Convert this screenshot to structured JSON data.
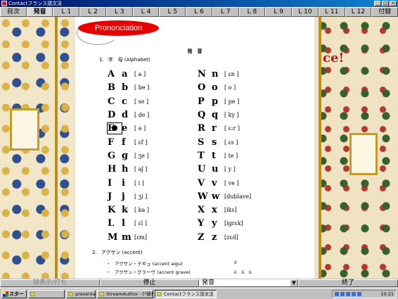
{
  "window": {
    "title": "Contactフランス語文法"
  },
  "tabs": [
    "目次",
    "発音",
    "L 1",
    "L 2",
    "L 3",
    "L 4",
    "L 5",
    "L 6",
    "L 7",
    "L 8",
    "L 9",
    "L 10",
    "L 11",
    "L 12",
    "付録"
  ],
  "active_tab": "発音",
  "document": {
    "badge": "Prononciation",
    "heading": "発　音",
    "section1": {
      "number": "1.",
      "title": "字　母 (Alphabet)"
    },
    "alphabet_left": [
      {
        "upper": "A",
        "lower": "a",
        "phon": "[ a ]"
      },
      {
        "upper": "B",
        "lower": "b",
        "phon": "[ be ]"
      },
      {
        "upper": "C",
        "lower": "c",
        "phon": "[ se ]"
      },
      {
        "upper": "D",
        "lower": "d",
        "phon": "[ de ]"
      },
      {
        "upper": "E",
        "lower": "e",
        "phon": "[ ə ]"
      },
      {
        "upper": "F",
        "lower": "f",
        "phon": "[ ɛf ]"
      },
      {
        "upper": "G",
        "lower": "g",
        "phon": "[ ʒe ]"
      },
      {
        "upper": "H",
        "lower": "h",
        "phon": "[ aʃ ]"
      },
      {
        "upper": "I",
        "lower": "i",
        "phon": "[ i ]"
      },
      {
        "upper": "J",
        "lower": "j",
        "phon": "[ ʒi ]"
      },
      {
        "upper": "K",
        "lower": "k",
        "phon": "[ ka ]"
      },
      {
        "upper": "L",
        "lower": "l",
        "phon": "[ ɛl ]"
      },
      {
        "upper": "M",
        "lower": "m",
        "phon": "[ɛm]"
      }
    ],
    "alphabet_right": [
      {
        "upper": "N",
        "lower": "n",
        "phon": "[ ɛn ]"
      },
      {
        "upper": "O",
        "lower": "o",
        "phon": "[ o ]"
      },
      {
        "upper": "P",
        "lower": "p",
        "phon": "[ pe ]"
      },
      {
        "upper": "Q",
        "lower": "q",
        "phon": "[ ky ]"
      },
      {
        "upper": "R",
        "lower": "r",
        "phon": "[ ɛ:r ]"
      },
      {
        "upper": "S",
        "lower": "s",
        "phon": "[ ɛs ]"
      },
      {
        "upper": "T",
        "lower": "t",
        "phon": "[ te ]"
      },
      {
        "upper": "U",
        "lower": "u",
        "phon": "[ y ]"
      },
      {
        "upper": "V",
        "lower": "v",
        "phon": "[ ve ]"
      },
      {
        "upper": "W",
        "lower": "w",
        "phon": "[dublave]"
      },
      {
        "upper": "X",
        "lower": "x",
        "phon": "[iks]"
      },
      {
        "upper": "Y",
        "lower": "y",
        "phon": "[igrɛk]"
      },
      {
        "upper": "Z",
        "lower": "z",
        "phon": "[zɛd]"
      }
    ],
    "selected_letter": "E",
    "section2": {
      "number": "2.",
      "title": "アクサン (accent)"
    },
    "accents": [
      {
        "bullet": "・",
        "label": "アクサン・テギュ (accent aigu)",
        "examples": "é"
      },
      {
        "bullet": "・",
        "label": "アクサン・グラーヴ (accent grave)",
        "examples": "è　à　ù"
      }
    ]
  },
  "decoration": {
    "right_text": "ce!"
  },
  "bottom_bar": {
    "left_label": "球表示/打ち",
    "stop_label": "停止",
    "select_value": "発音",
    "end_label": "終了"
  },
  "taskbar": {
    "start_label": "スタート",
    "tasks": [
      {
        "label": "presentations",
        "active": false
      },
      {
        "label": "StreamAuthor - [*新規...",
        "active": false
      },
      {
        "label": "Contactフランス語文法",
        "active": true
      }
    ],
    "clock": "10:21"
  }
}
